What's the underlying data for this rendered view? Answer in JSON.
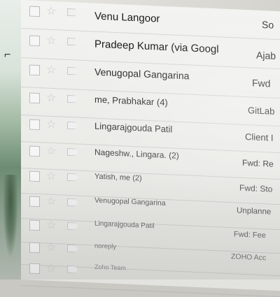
{
  "emails": [
    {
      "sender": "Venu Langoor",
      "subject": "So"
    },
    {
      "sender": "Pradeep Kumar (via Googl",
      "subject": "Ajab"
    },
    {
      "sender": "Venugopal Gangarina",
      "subject": "Fwd"
    },
    {
      "sender": "me, Prabhakar (4)",
      "subject": "GitLab"
    },
    {
      "sender": "Lingarajgouda Patil",
      "subject": "Client I"
    },
    {
      "sender": "Nageshw., Lingara. (2)",
      "subject": "Fwd: Re"
    },
    {
      "sender": "Yatish, me (2)",
      "subject": "Fwd: Sto"
    },
    {
      "sender": "Venugopal Gangarina",
      "subject": "Unplanne"
    },
    {
      "sender": "Lingarajgouda Patil",
      "subject": "Fwd: Fee"
    },
    {
      "sender": "noreply",
      "subject": "ZOHO Acc"
    },
    {
      "sender": "Zoho Team",
      "subject": ""
    }
  ],
  "icons": {
    "checkbox": "checkbox-icon",
    "star": "star-icon",
    "importance": "importance-marker-icon"
  }
}
